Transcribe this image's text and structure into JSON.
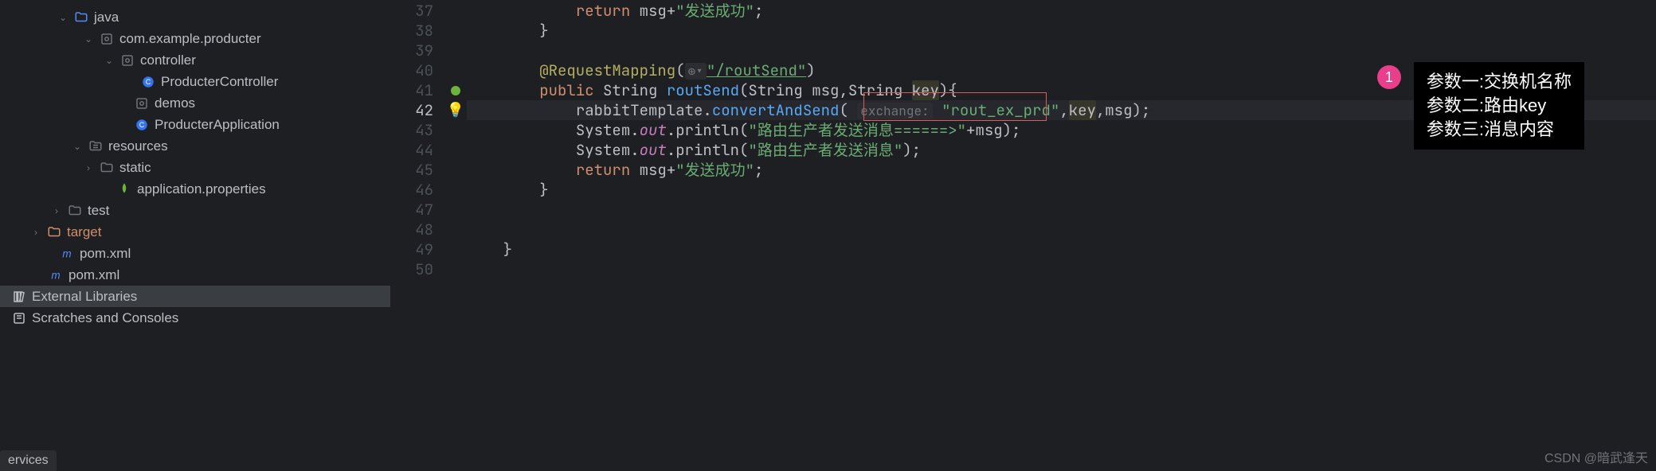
{
  "tree": {
    "java": "java",
    "pkg": "com.example.producter",
    "controller": "controller",
    "producter_controller": "ProducterController",
    "demos": "demos",
    "producter_app": "ProducterApplication",
    "resources": "resources",
    "static": "static",
    "app_props": "application.properties",
    "test": "test",
    "target": "target",
    "pom_inner": "pom.xml",
    "pom_outer": "pom.xml",
    "ext_libs": "External Libraries",
    "scratches": "Scratches and Consoles"
  },
  "lines": {
    "37": 37,
    "38": 38,
    "39": 39,
    "40": 40,
    "41": 41,
    "42": 42,
    "43": 43,
    "44": 44,
    "45": 45,
    "46": 46,
    "47": 47,
    "48": 48,
    "49": 49,
    "50": 50
  },
  "code": {
    "return37": "return",
    "msg37": " msg+",
    "str37": "\"发送成功\"",
    "semi": ";",
    "brace_close": "}",
    "ann_name": "@RequestMapping",
    "ann_open": "(",
    "ann_icon_hint": "",
    "route": "\"/routSend\"",
    "ann_close": ")",
    "public": "public",
    "string_t": "String",
    "fn_name": "routSend",
    "params_open": "(String msg,String ",
    "key_param": "key",
    "params_close": "){",
    "rabbit": "rabbitTemplate.",
    "convert": "convertAndSend",
    "hint_exchange": "exchange:",
    "arg_route": "\"rout_ex_prd\"",
    "comma_key": ",",
    "key_arg": "key",
    "comma_msg": ",msg);",
    "sysout_pre": "System.",
    "out": "out",
    "println": ".println(",
    "str43": "\"路由生产者发送消息======>\"",
    "plus_msg": "+msg);",
    "str44": "\"路由生产者发送消息\"",
    "close44": ");",
    "return45": "return",
    "msg45": " msg+",
    "str45": "\"发送成功\""
  },
  "callout": {
    "num": "1",
    "l1": "参数一:交换机名称",
    "l2": "参数二:路由key",
    "l3": "参数三:消息内容"
  },
  "bottom": {
    "tab": "ervices",
    "watermark": "CSDN @暗武逢天"
  }
}
